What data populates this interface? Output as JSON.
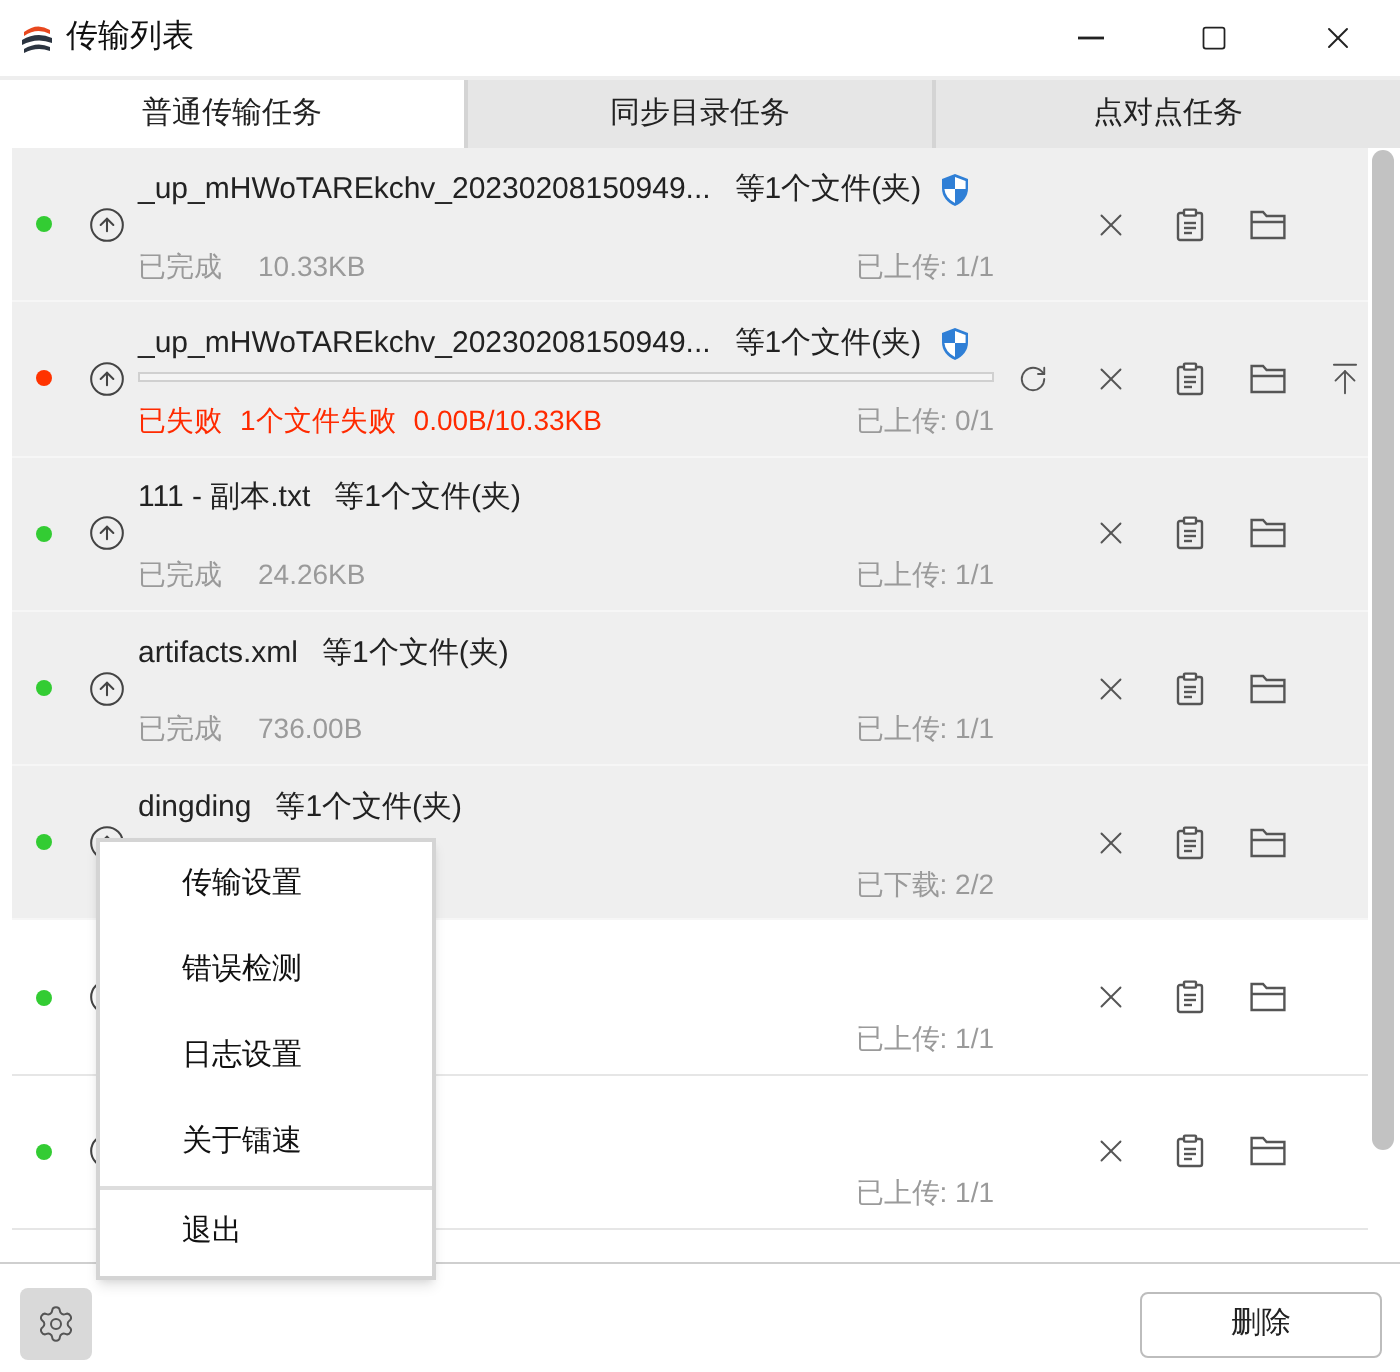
{
  "window": {
    "title": "传输列表"
  },
  "tabs": [
    {
      "label": "普通传输任务",
      "selected": true
    },
    {
      "label": "同步目录任务",
      "selected": false
    },
    {
      "label": "点对点任务",
      "selected": false
    }
  ],
  "rows": [
    {
      "selected": true,
      "color": "#33cc33",
      "kind": "done",
      "name": "_up_mHWoTAREkchv_20230208150949...",
      "count": "等1个文件(夹)",
      "verified": true,
      "status": "已完成",
      "size": "10.33KB",
      "progress": "已上传: 1/1",
      "hovered": false
    },
    {
      "selected": true,
      "color": "#ff3300",
      "kind": "failed",
      "name": "_up_mHWoTAREkchv_20230208150949...",
      "count": "等1个文件(夹)",
      "verified": true,
      "level": 0,
      "status": "已失败",
      "failure": "1个文件失败",
      "size": "0.00B/10.33KB",
      "progress": "已上传: 0/1",
      "hovered": true
    },
    {
      "selected": true,
      "color": "#33cc33",
      "kind": "done",
      "name": "111 - 副本.txt",
      "count": "等1个文件(夹)",
      "verified": false,
      "status": "已完成",
      "size": "24.26KB",
      "progress": "已上传: 1/1",
      "hovered": false
    },
    {
      "selected": true,
      "color": "#33cc33",
      "kind": "done",
      "name": "artifacts.xml",
      "count": "等1个文件(夹)",
      "verified": false,
      "status": "已完成",
      "size": "736.00B",
      "progress": "已上传: 1/1",
      "hovered": false
    },
    {
      "selected": true,
      "color": "#33cc33",
      "kind": "done",
      "name": "dingding",
      "count": "等1个文件(夹)",
      "verified": false,
      "progress": "已下载: 2/2",
      "hovered": false
    },
    {
      "selected": false,
      "color": "#33cc33",
      "kind": "done",
      "verified": false,
      "progress": "已上传: 1/1",
      "hovered": false
    },
    {
      "selected": false,
      "color": "#33cc33",
      "kind": "done",
      "verified": false,
      "progress": "已上传: 1/1",
      "hovered": false
    }
  ],
  "menu": {
    "groups": [
      {
        "items": [
          {
            "label": "传输设置"
          },
          {
            "label": "错误检测"
          },
          {
            "label": "日志设置"
          },
          {
            "label": "关于镭速"
          }
        ]
      },
      {
        "items": [
          {
            "label": "退出"
          }
        ]
      }
    ]
  },
  "footer": {
    "delete_button": "删除"
  }
}
